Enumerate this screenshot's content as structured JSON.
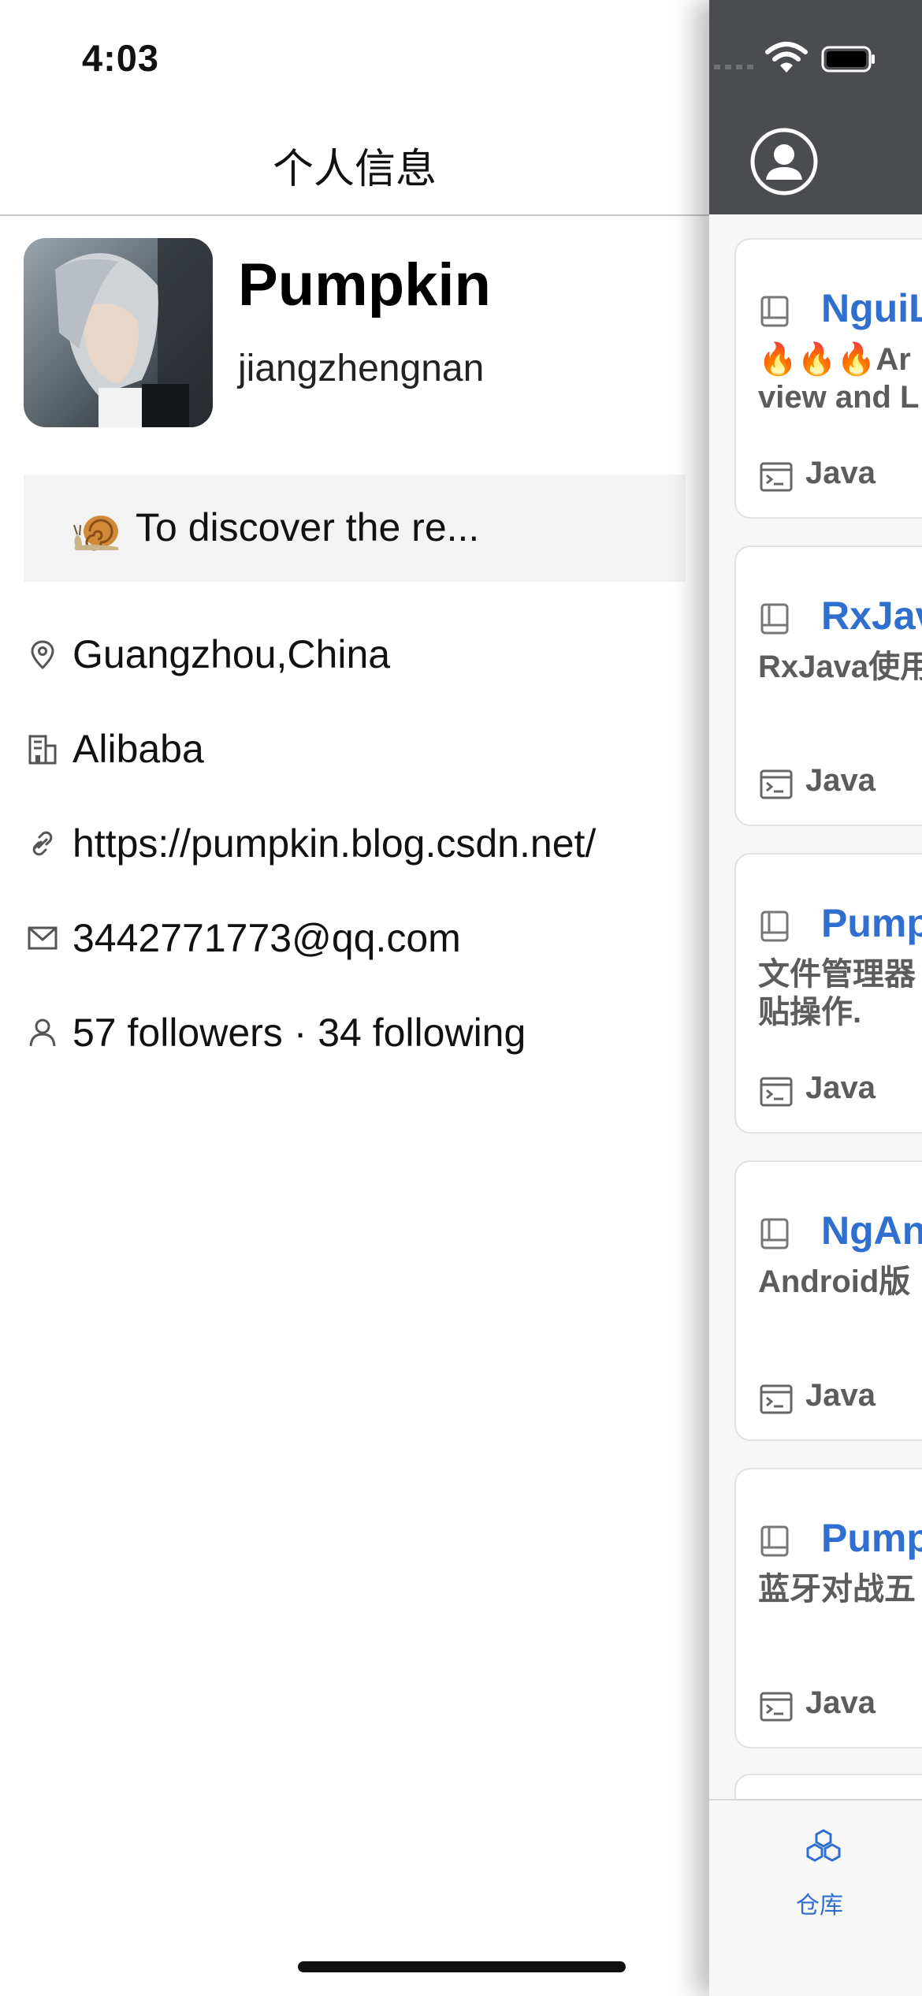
{
  "status_bar": {
    "time": "4:03"
  },
  "drawer": {
    "title": "个人信息",
    "profile": {
      "display_name": "Pumpkin",
      "login": "jiangzhengnan",
      "bio": "To discover the re...",
      "bio_icon": "snail-emoji"
    },
    "info": [
      {
        "icon": "location-icon",
        "text": "Guangzhou,China"
      },
      {
        "icon": "company-icon",
        "text": "Alibaba"
      },
      {
        "icon": "link-icon",
        "text": "https://pumpkin.blog.csdn.net/"
      },
      {
        "icon": "mail-icon",
        "text": "3442771773@qq.com"
      },
      {
        "icon": "person-icon",
        "text": "57 followers · 34 following"
      }
    ]
  },
  "main": {
    "header_icon": "profile-icon",
    "repos": [
      {
        "name": "NguiL",
        "description": "🔥🔥🔥Ar\nview and L",
        "language": "Java"
      },
      {
        "name": "RxJav",
        "description": "RxJava使用",
        "language": "Java"
      },
      {
        "name": "Pump",
        "description": "文件管理器\n贴操作.",
        "language": "Java"
      },
      {
        "name": "NgAnd",
        "description": "Android版",
        "language": "Java"
      },
      {
        "name": "Pump",
        "description": "蓝牙对战五",
        "language": "Java"
      }
    ],
    "tabbar": {
      "label": "仓库",
      "icon": "repository-cubes-icon"
    }
  },
  "colors": {
    "accent_blue": "#2f6fd0",
    "header_gray": "#4a4c4f",
    "bio_background": "#f3f3f3"
  }
}
